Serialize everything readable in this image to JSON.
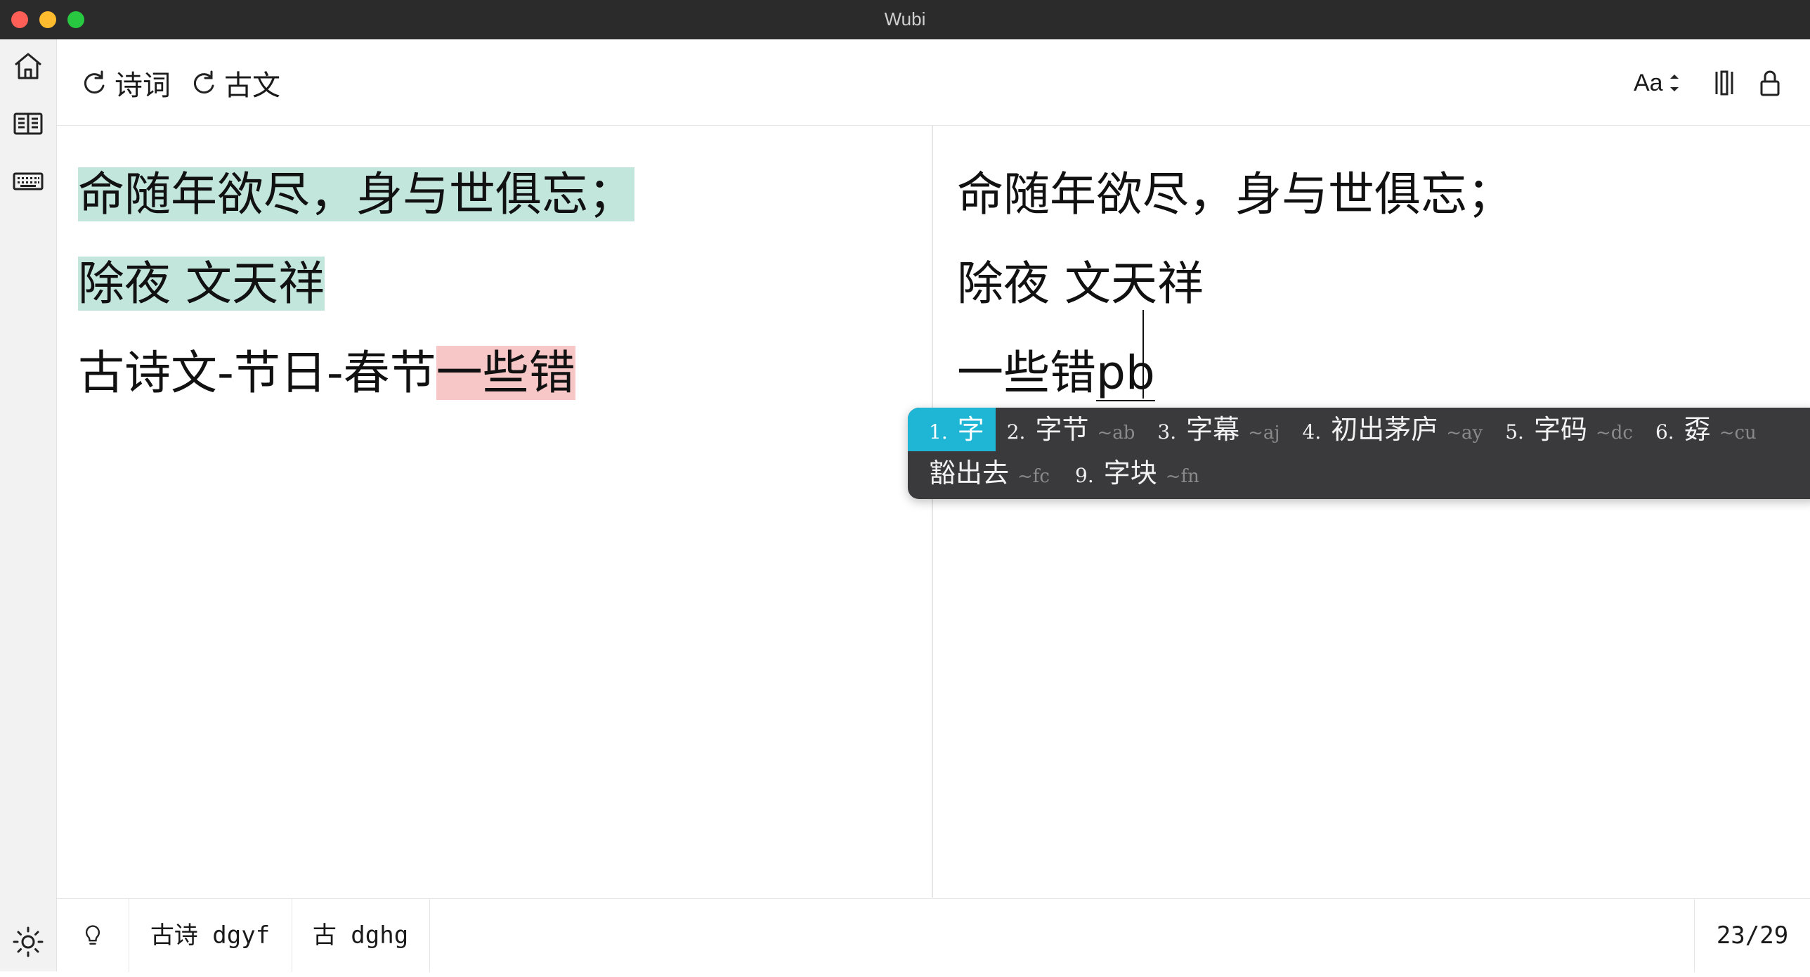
{
  "window": {
    "title": "Wubi"
  },
  "sidebar": {
    "items": [
      {
        "icon": "home-icon"
      },
      {
        "icon": "book-icon"
      },
      {
        "icon": "keyboard-icon"
      }
    ],
    "bottom_icon": "sun-icon"
  },
  "toolbar": {
    "buttons": [
      {
        "icon": "refresh-icon",
        "label": "诗词"
      },
      {
        "icon": "refresh-icon",
        "label": "古文"
      }
    ],
    "font_size_label": "Aa",
    "right_icons": [
      "font-size-icon",
      "columns-icon",
      "lock-icon"
    ]
  },
  "reference": {
    "line1": "命随年欲尽，身与世俱忘；",
    "line2": "除夜 文天祥",
    "line3_normal": "古诗文-节日-春节",
    "line3_error": "一些错"
  },
  "input": {
    "line1": "命随年欲尽，身与世俱忘；",
    "line2": "除夜 文天祥",
    "line3_committed": "一些错",
    "line3_composing": "pb"
  },
  "ime": {
    "candidates_row1": [
      {
        "num": "1.",
        "text": "字",
        "code": "",
        "selected": true
      },
      {
        "num": "2.",
        "text": "字节",
        "code": "~ab"
      },
      {
        "num": "3.",
        "text": "字幕",
        "code": "~aj"
      },
      {
        "num": "4.",
        "text": "初出茅庐",
        "code": "~ay"
      },
      {
        "num": "5.",
        "text": "字码",
        "code": "~dc"
      },
      {
        "num": "6.",
        "text": "孬",
        "code": "~cu"
      }
    ],
    "candidates_row2": [
      {
        "num": "",
        "text": "豁出去",
        "code": "~fc"
      },
      {
        "num": "9.",
        "text": "字块",
        "code": "~fn"
      }
    ]
  },
  "status": {
    "hint_icon": "lightbulb-icon",
    "hint1": "古诗 dgyf",
    "hint2": "古 dghg",
    "progress": "23/29"
  }
}
